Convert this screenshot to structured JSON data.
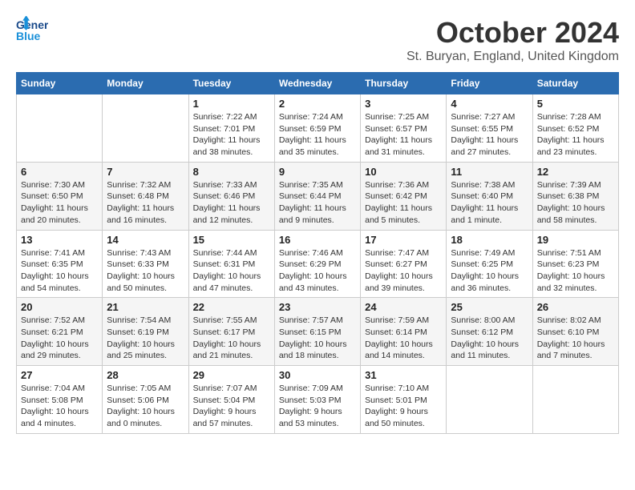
{
  "header": {
    "logo_line1": "General",
    "logo_line2": "Blue",
    "month": "October 2024",
    "location": "St. Buryan, England, United Kingdom"
  },
  "weekdays": [
    "Sunday",
    "Monday",
    "Tuesday",
    "Wednesday",
    "Thursday",
    "Friday",
    "Saturday"
  ],
  "weeks": [
    [
      {
        "day": "",
        "detail": ""
      },
      {
        "day": "",
        "detail": ""
      },
      {
        "day": "1",
        "detail": "Sunrise: 7:22 AM\nSunset: 7:01 PM\nDaylight: 11 hours and 38 minutes."
      },
      {
        "day": "2",
        "detail": "Sunrise: 7:24 AM\nSunset: 6:59 PM\nDaylight: 11 hours and 35 minutes."
      },
      {
        "day": "3",
        "detail": "Sunrise: 7:25 AM\nSunset: 6:57 PM\nDaylight: 11 hours and 31 minutes."
      },
      {
        "day": "4",
        "detail": "Sunrise: 7:27 AM\nSunset: 6:55 PM\nDaylight: 11 hours and 27 minutes."
      },
      {
        "day": "5",
        "detail": "Sunrise: 7:28 AM\nSunset: 6:52 PM\nDaylight: 11 hours and 23 minutes."
      }
    ],
    [
      {
        "day": "6",
        "detail": "Sunrise: 7:30 AM\nSunset: 6:50 PM\nDaylight: 11 hours and 20 minutes."
      },
      {
        "day": "7",
        "detail": "Sunrise: 7:32 AM\nSunset: 6:48 PM\nDaylight: 11 hours and 16 minutes."
      },
      {
        "day": "8",
        "detail": "Sunrise: 7:33 AM\nSunset: 6:46 PM\nDaylight: 11 hours and 12 minutes."
      },
      {
        "day": "9",
        "detail": "Sunrise: 7:35 AM\nSunset: 6:44 PM\nDaylight: 11 hours and 9 minutes."
      },
      {
        "day": "10",
        "detail": "Sunrise: 7:36 AM\nSunset: 6:42 PM\nDaylight: 11 hours and 5 minutes."
      },
      {
        "day": "11",
        "detail": "Sunrise: 7:38 AM\nSunset: 6:40 PM\nDaylight: 11 hours and 1 minute."
      },
      {
        "day": "12",
        "detail": "Sunrise: 7:39 AM\nSunset: 6:38 PM\nDaylight: 10 hours and 58 minutes."
      }
    ],
    [
      {
        "day": "13",
        "detail": "Sunrise: 7:41 AM\nSunset: 6:35 PM\nDaylight: 10 hours and 54 minutes."
      },
      {
        "day": "14",
        "detail": "Sunrise: 7:43 AM\nSunset: 6:33 PM\nDaylight: 10 hours and 50 minutes."
      },
      {
        "day": "15",
        "detail": "Sunrise: 7:44 AM\nSunset: 6:31 PM\nDaylight: 10 hours and 47 minutes."
      },
      {
        "day": "16",
        "detail": "Sunrise: 7:46 AM\nSunset: 6:29 PM\nDaylight: 10 hours and 43 minutes."
      },
      {
        "day": "17",
        "detail": "Sunrise: 7:47 AM\nSunset: 6:27 PM\nDaylight: 10 hours and 39 minutes."
      },
      {
        "day": "18",
        "detail": "Sunrise: 7:49 AM\nSunset: 6:25 PM\nDaylight: 10 hours and 36 minutes."
      },
      {
        "day": "19",
        "detail": "Sunrise: 7:51 AM\nSunset: 6:23 PM\nDaylight: 10 hours and 32 minutes."
      }
    ],
    [
      {
        "day": "20",
        "detail": "Sunrise: 7:52 AM\nSunset: 6:21 PM\nDaylight: 10 hours and 29 minutes."
      },
      {
        "day": "21",
        "detail": "Sunrise: 7:54 AM\nSunset: 6:19 PM\nDaylight: 10 hours and 25 minutes."
      },
      {
        "day": "22",
        "detail": "Sunrise: 7:55 AM\nSunset: 6:17 PM\nDaylight: 10 hours and 21 minutes."
      },
      {
        "day": "23",
        "detail": "Sunrise: 7:57 AM\nSunset: 6:15 PM\nDaylight: 10 hours and 18 minutes."
      },
      {
        "day": "24",
        "detail": "Sunrise: 7:59 AM\nSunset: 6:14 PM\nDaylight: 10 hours and 14 minutes."
      },
      {
        "day": "25",
        "detail": "Sunrise: 8:00 AM\nSunset: 6:12 PM\nDaylight: 10 hours and 11 minutes."
      },
      {
        "day": "26",
        "detail": "Sunrise: 8:02 AM\nSunset: 6:10 PM\nDaylight: 10 hours and 7 minutes."
      }
    ],
    [
      {
        "day": "27",
        "detail": "Sunrise: 7:04 AM\nSunset: 5:08 PM\nDaylight: 10 hours and 4 minutes."
      },
      {
        "day": "28",
        "detail": "Sunrise: 7:05 AM\nSunset: 5:06 PM\nDaylight: 10 hours and 0 minutes."
      },
      {
        "day": "29",
        "detail": "Sunrise: 7:07 AM\nSunset: 5:04 PM\nDaylight: 9 hours and 57 minutes."
      },
      {
        "day": "30",
        "detail": "Sunrise: 7:09 AM\nSunset: 5:03 PM\nDaylight: 9 hours and 53 minutes."
      },
      {
        "day": "31",
        "detail": "Sunrise: 7:10 AM\nSunset: 5:01 PM\nDaylight: 9 hours and 50 minutes."
      },
      {
        "day": "",
        "detail": ""
      },
      {
        "day": "",
        "detail": ""
      }
    ]
  ]
}
